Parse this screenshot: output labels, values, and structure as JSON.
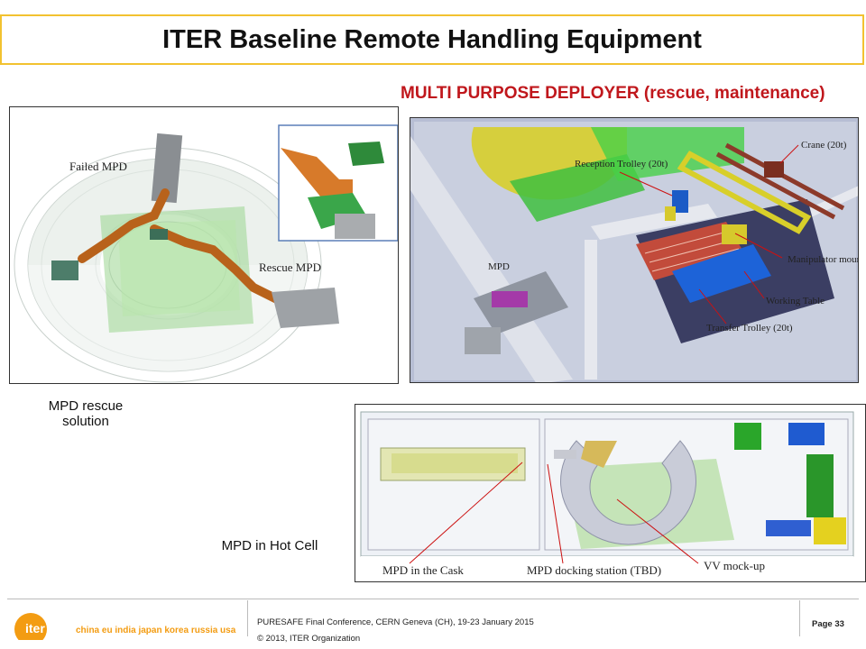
{
  "title": "ITER Baseline Remote Handling Equipment",
  "subtitle": "MULTI PURPOSE DEPLOYER (rescue, maintenance)",
  "panel_rescue": {
    "label_failed": "Failed MPD",
    "label_rescue": "Rescue MPD"
  },
  "panel_deployer": {
    "label_crane": "Crane (20t)",
    "label_reception": "Reception Trolley (20t)",
    "label_mpd": "MPD",
    "label_manipulator": "Manipulator mounted crane",
    "label_working": "Working Table",
    "label_transfer": "Transfer Trolley (20t)"
  },
  "panel_hotcell": {
    "label_cask": "MPD in the Cask",
    "label_docking": "MPD docking station (TBD)",
    "label_vv": "VV mock-up"
  },
  "captions": {
    "rescue": "MPD rescue solution",
    "hotcell": "MPD in Hot Cell"
  },
  "footer": {
    "conference": "PURESAFE Final Conference, CERN Geneva (CH), 19-23 January 2015",
    "copyright": "© 2013, ITER Organization",
    "page": "Page 33",
    "logo_text": "iter",
    "tagline": "china eu india japan korea russia usa"
  },
  "colors": {
    "accent_border": "#f2c230",
    "subtitle_red": "#c0171c",
    "logo_orange": "#f39c12"
  }
}
